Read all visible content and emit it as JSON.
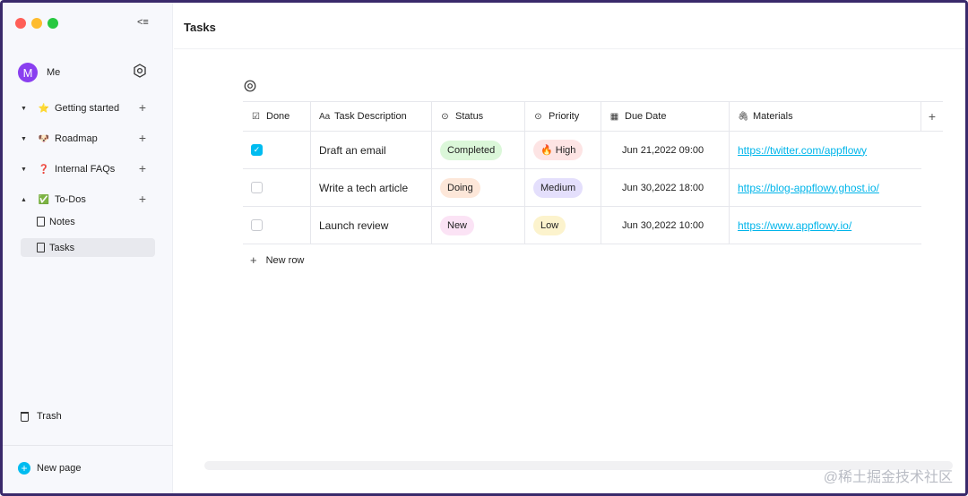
{
  "window": {
    "traffic_lights": [
      "#ff5f57",
      "#febc2e",
      "#28c840"
    ],
    "collapse_icon": "collapse-sidebar-icon"
  },
  "sidebar": {
    "user": {
      "avatar_letter": "M",
      "name": "Me",
      "avatar_color": "#8a3ff0"
    },
    "items": [
      {
        "label": "Getting started",
        "emoji": "⭐"
      },
      {
        "label": "Roadmap",
        "emoji": "🐶"
      },
      {
        "label": "Internal FAQs",
        "emoji": "❓"
      },
      {
        "label": "To-Dos",
        "emoji": "✅"
      }
    ],
    "subitems": [
      {
        "label": "Notes"
      },
      {
        "label": "Tasks"
      }
    ],
    "trash_label": "Trash",
    "new_page_label": "New page"
  },
  "main": {
    "title": "Tasks",
    "columns": [
      {
        "label": "Done",
        "icon": "☑"
      },
      {
        "label": "Task Description",
        "icon": "Aa"
      },
      {
        "label": "Status",
        "icon": "⊙"
      },
      {
        "label": "Priority",
        "icon": "⊙"
      },
      {
        "label": "Due Date",
        "icon": "▦"
      },
      {
        "label": "Materials",
        "icon": "🖇"
      }
    ],
    "rows": [
      {
        "done": true,
        "description": "Draft an email",
        "status": "Completed",
        "status_color": "#dbf7d9",
        "priority": "🔥 High",
        "priority_color": "#fde4e4",
        "due": "Jun 21,2022  09:00",
        "material": "https://twitter.com/appflowy"
      },
      {
        "done": false,
        "description": "Write a tech article",
        "status": "Doing",
        "status_color": "#fde7d9",
        "priority": "Medium",
        "priority_color": "#e4dffc",
        "due": "Jun 30,2022  18:00",
        "material": "https://blog-appflowy.ghost.io/"
      },
      {
        "done": false,
        "description": "Launch review",
        "status": "New",
        "status_color": "#fbe3f5",
        "priority": "Low",
        "priority_color": "#fcf3cd",
        "due": "Jun 30,2022  10:00",
        "material": "https://www.appflowy.io/"
      }
    ],
    "new_row_label": "New row",
    "watermark": "@稀土掘金技术社区"
  }
}
